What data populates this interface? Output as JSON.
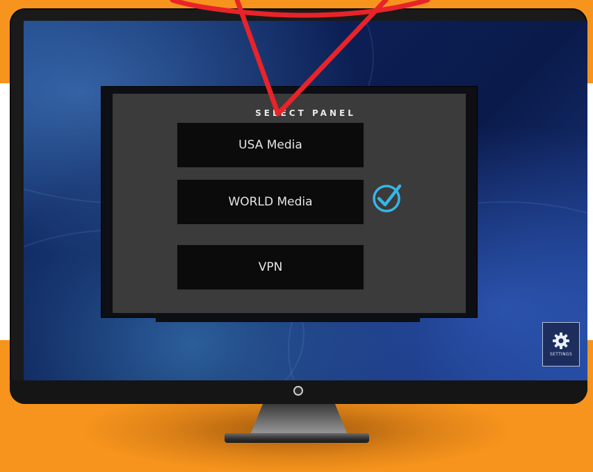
{
  "panel": {
    "title": "SELECT PANEL",
    "options": [
      {
        "label": "USA Media",
        "selected": false
      },
      {
        "label": "WORLD Media",
        "selected": true
      },
      {
        "label": "VPN",
        "selected": false
      }
    ]
  },
  "settings": {
    "label": "SETTINGS",
    "icon": "gear-icon"
  },
  "icons": {
    "selected_marker": "checkmark-circle-icon"
  },
  "colors": {
    "background_orange": "#f7941d",
    "checkmark": "#36b6e6",
    "callout": "#e8232a",
    "button_bg": "#0b0b0b",
    "panel_bg": "#3b3b3b"
  }
}
